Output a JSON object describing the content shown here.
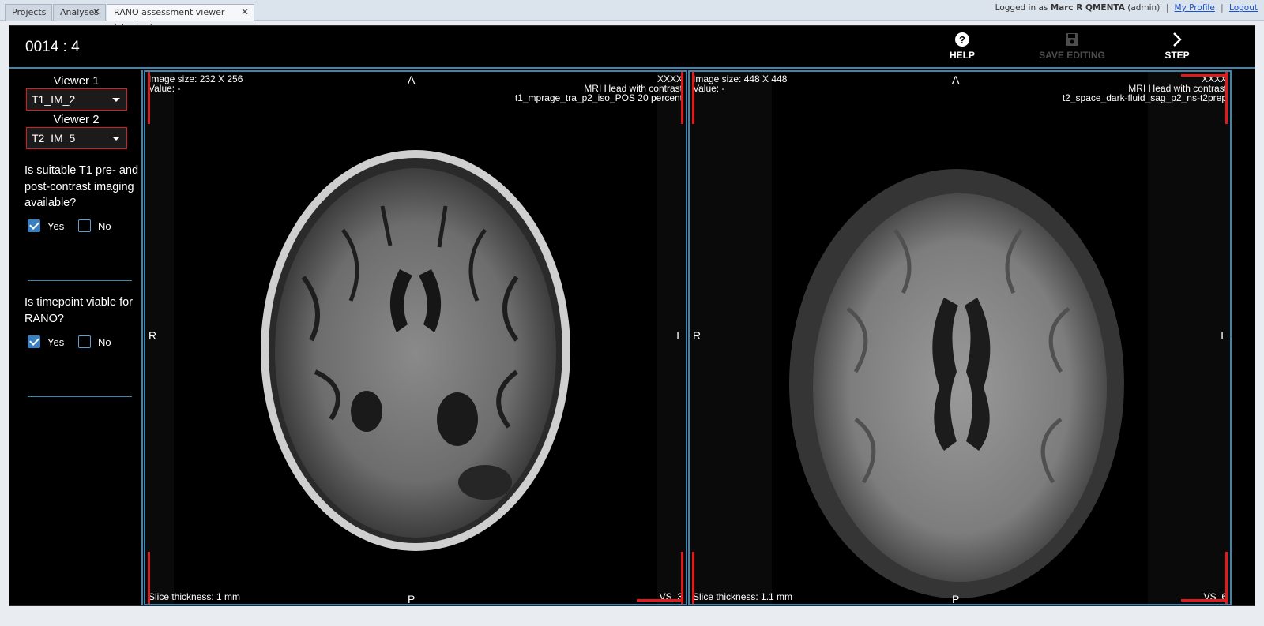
{
  "tabs": [
    {
      "label": "Projects",
      "active": false
    },
    {
      "label": "Analyses",
      "active": false,
      "closable": true
    },
    {
      "label": "RANO assessment viewer (staging)",
      "active": true,
      "closable": true
    }
  ],
  "login": {
    "prefix": "Logged in as",
    "user": "Marc R QMENTA",
    "role": "(admin)",
    "profile": "My Profile",
    "logout": "Logout"
  },
  "header": {
    "title": "0014 : 4",
    "help": "HELP",
    "save": "SAVE EDITING",
    "step": "STEP"
  },
  "sidebar": {
    "viewer1_label": "Viewer 1",
    "viewer1_value": "T1_IM_2",
    "viewer2_label": "Viewer 2",
    "viewer2_value": "T2_IM_5",
    "q1": "Is suitable T1 pre- and post-contrast imaging available?",
    "q1_yes": "Yes",
    "q1_no": "No",
    "q1_yes_checked": true,
    "q1_no_checked": false,
    "q2": "Is timepoint viable for RANO?",
    "q2_yes": "Yes",
    "q2_no": "No",
    "q2_yes_checked": true,
    "q2_no_checked": false
  },
  "viewer1": {
    "size": "Image size: 232 X 256",
    "value": "Value: -",
    "id": "XXXX",
    "desc": "MRI Head with contrast",
    "series": "t1_mprage_tra_p2_iso_POS 20 percent",
    "top": "A",
    "bottom": "P",
    "left": "R",
    "right": "L",
    "slice": "Slice thickness: 1 mm",
    "vs": "VS_3"
  },
  "viewer2": {
    "size": "Image size: 448 X 448",
    "value": "Value: -",
    "id": "XXXX",
    "desc": "MRI Head with contrast",
    "series": "t2_space_dark-fluid_sag_p2_ns-t2prep",
    "top": "A",
    "bottom": "P",
    "left": "R",
    "right": "L",
    "slice": "Slice thickness: 1.1 mm",
    "vs": "VS_6"
  },
  "colors": {
    "accent": "#3b86b0",
    "marker": "#e01b1b",
    "checkbox": "#3a7fc0"
  }
}
